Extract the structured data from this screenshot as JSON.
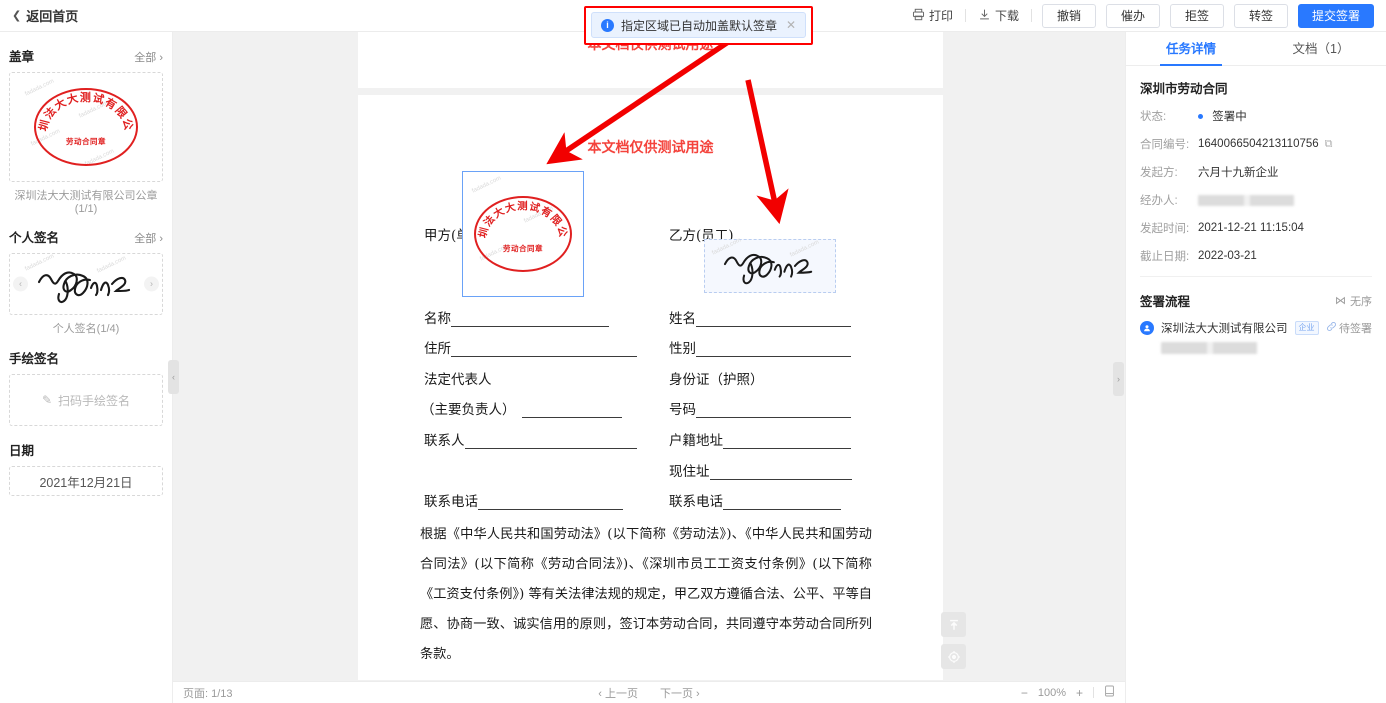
{
  "topbar": {
    "back_label": "返回首页",
    "print_label": "打印",
    "download_label": "下载",
    "buttons": [
      {
        "label": "撤销"
      },
      {
        "label": "催办"
      },
      {
        "label": "拒签"
      },
      {
        "label": "转签"
      }
    ],
    "primary_label": "提交签署",
    "accent_color": "#2979ff"
  },
  "toast": {
    "message": "指定区域已自动加盖默认签章",
    "info_glyph": "i",
    "close_glyph": "✕",
    "highlight_color": "#fe0000"
  },
  "sidebar": {
    "seal": {
      "title": "盖章",
      "all_label": "全部",
      "caption": "深圳法大大测试有限公司公章(1/1)",
      "stamp_ring_text": "深圳法大大测试有限公司",
      "stamp_center_text": "劳动合同章",
      "watermark": "fadada.com",
      "stamp_color": "#e02020"
    },
    "personal_signature": {
      "title": "个人签名",
      "all_label": "全部",
      "caption": "个人签名(1/4)",
      "prev_glyph": "‹",
      "next_glyph": "›"
    },
    "handdrawn": {
      "title": "手绘签名",
      "placeholder": "扫码手绘签名",
      "pen_glyph": "✎"
    },
    "date": {
      "title": "日期",
      "value": "2021年12月21日"
    },
    "collapse_left_glyph": "‹",
    "collapse_right_glyph": "›"
  },
  "document": {
    "watermark_line_1": "本文档仅供测试用途",
    "watermark_line_2": "本文档仅供测试用途",
    "party_a_label": "甲方(单位)",
    "party_b_label": "乙方(员工)",
    "fields_left": [
      {
        "label": "名称"
      },
      {
        "label": "住所"
      },
      {
        "label": "法定代表人"
      },
      {
        "label": "（主要负责人）"
      },
      {
        "label": "联系人"
      },
      {
        "label": "联系电话"
      }
    ],
    "fields_right": [
      {
        "label": "姓名"
      },
      {
        "label": "性别"
      },
      {
        "label": "身份证（护照）"
      },
      {
        "label": "号码"
      },
      {
        "label": "户籍地址"
      },
      {
        "label": "现住址"
      },
      {
        "label": "联系电话"
      }
    ],
    "paragraph": "根据《中华人民共和国劳动法》(以下简称《劳动法》)、《中华人民共和国劳动合同法》(以下简称《劳动合同法》)、《深圳市员工工资支付条例》(以下简称《工资支付条例》) 等有关法律法规的规定，甲乙双方遵循合法、公平、平等自愿、协商一致、诚实信用的原则，签订本劳动合同，共同遵守本劳动合同所列条款。",
    "placed_stamp_center_text": "劳动合同章",
    "placed_stamp_ring_text": "深圳法大大测试有限公司"
  },
  "float_buttons": {
    "scroll_top_glyph": "⬆",
    "locate_glyph": "◎"
  },
  "bottombar": {
    "page_label": "页面: 1/13",
    "prev_page": "‹ 上一页",
    "next_page": "下一页 ›",
    "zoom_out": "−",
    "zoom_level": "100%",
    "zoom_in": "+",
    "fit_glyph": "▯"
  },
  "rightpanel": {
    "tabs": [
      {
        "label": "任务详情",
        "active": true
      },
      {
        "label": "文档（1）",
        "active": false
      }
    ],
    "doc_title": "深圳市劳动合同",
    "rows": [
      {
        "key": "状态:",
        "value": "签署中",
        "type": "status"
      },
      {
        "key": "合同编号:",
        "value": "1640066504213110756",
        "type": "copy"
      },
      {
        "key": "发起方:",
        "value": "六月十九新企业",
        "type": "text"
      },
      {
        "key": "经办人:",
        "value": "",
        "type": "blurred"
      },
      {
        "key": "发起时间:",
        "value": "2021-12-21 11:15:04",
        "type": "text"
      },
      {
        "key": "截止日期:",
        "value": "2022-03-21",
        "type": "text"
      }
    ],
    "copy_glyph": "⧉",
    "flow": {
      "title": "签署流程",
      "order_label": "无序",
      "order_glyph": "⋈",
      "participants": [
        {
          "name": "深圳法大大测试有限公司",
          "badge": "企业",
          "link_glyph": "🔗",
          "status": "待签署",
          "avatar_glyph": "●"
        }
      ]
    }
  }
}
